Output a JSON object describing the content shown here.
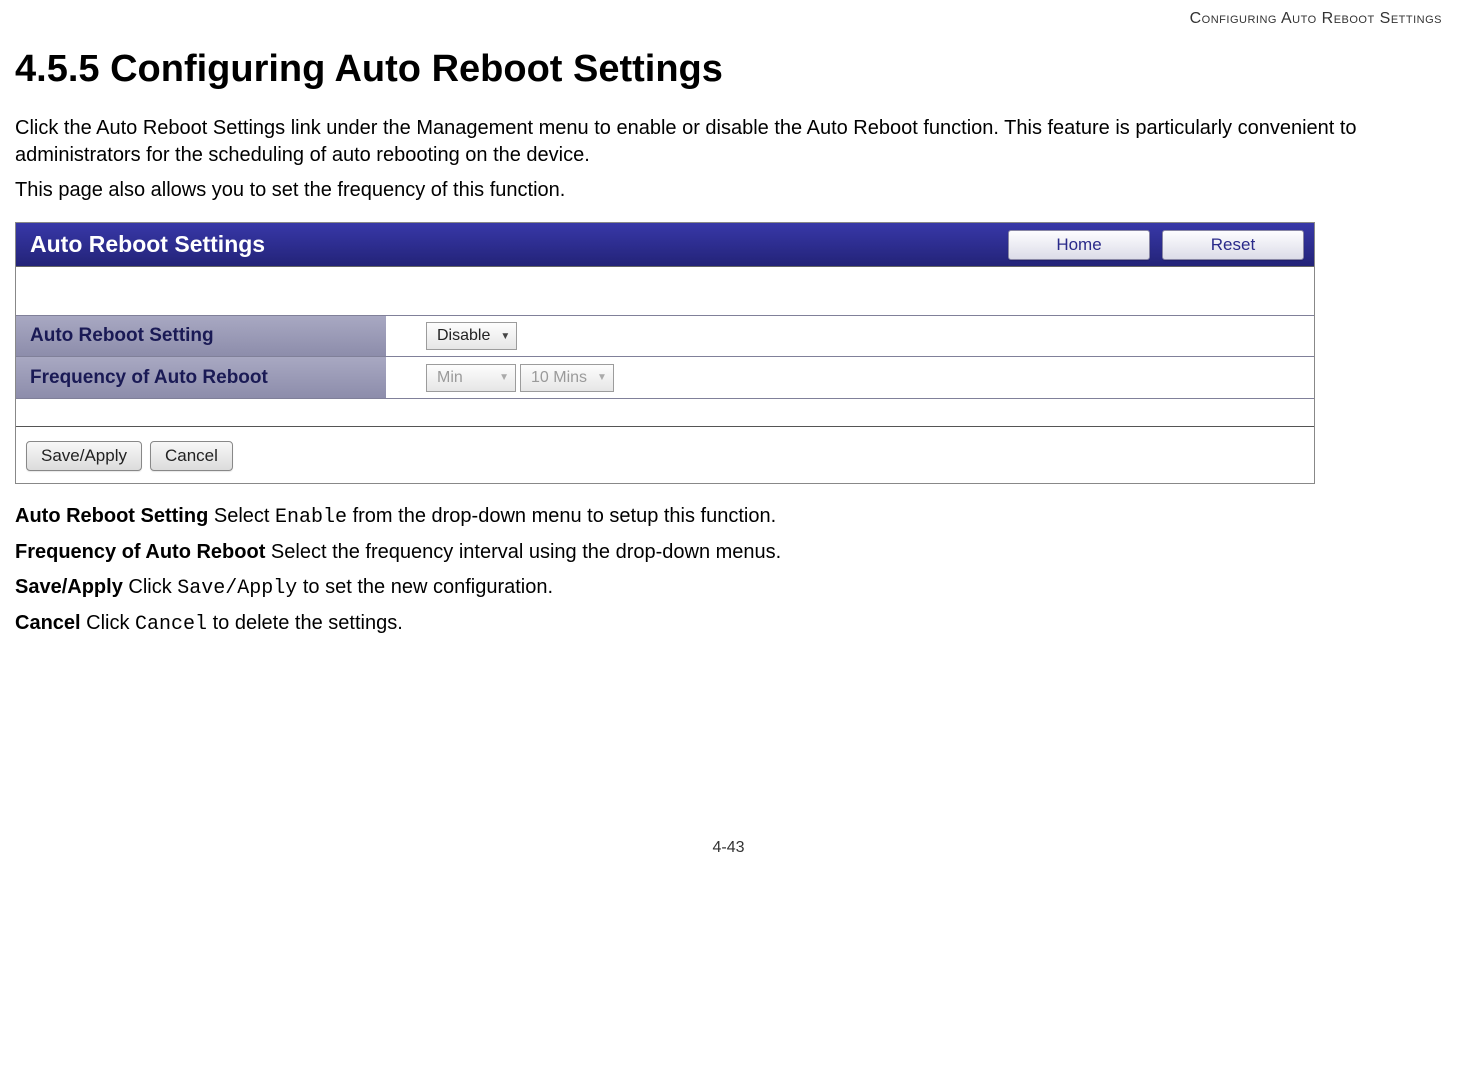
{
  "page": {
    "header_small": "Configuring Auto Reboot Settings",
    "section_title": "4.5.5 Configuring Auto Reboot Settings",
    "para1": "Click the Auto Reboot Settings link under the Management menu to enable or disable the Auto Reboot function. This feature is particularly convenient to administrators for the scheduling of auto rebooting on the device.",
    "para2": "This page also allows you to set the frequency of this function.",
    "footer": "4-43"
  },
  "screenshot": {
    "title": "Auto Reboot Settings",
    "home_btn": "Home",
    "reset_btn": "Reset",
    "rows": {
      "setting_label": "Auto Reboot Setting",
      "setting_value": "Disable",
      "freq_label": "Frequency of Auto Reboot",
      "freq_unit": "Min",
      "freq_value": "10 Mins"
    },
    "save_apply": "Save/Apply",
    "cancel": "Cancel"
  },
  "defs": {
    "d1_term": "Auto Reboot Setting",
    "d1_pre": "  Select ",
    "d1_mono": "Enable",
    "d1_post": " from the drop-down menu to setup this function.",
    "d2_term": "Frequency of Auto Reboot",
    "d2_post": "  Select the frequency interval using the drop-down menus.",
    "d3_term": "Save/Apply",
    "d3_pre": "  Click ",
    "d3_mono": "Save/Apply",
    "d3_post": " to set the new configuration.",
    "d4_term": "Cancel",
    "d4_pre": "  Click ",
    "d4_mono": "Cancel",
    "d4_post": " to delete the settings."
  }
}
